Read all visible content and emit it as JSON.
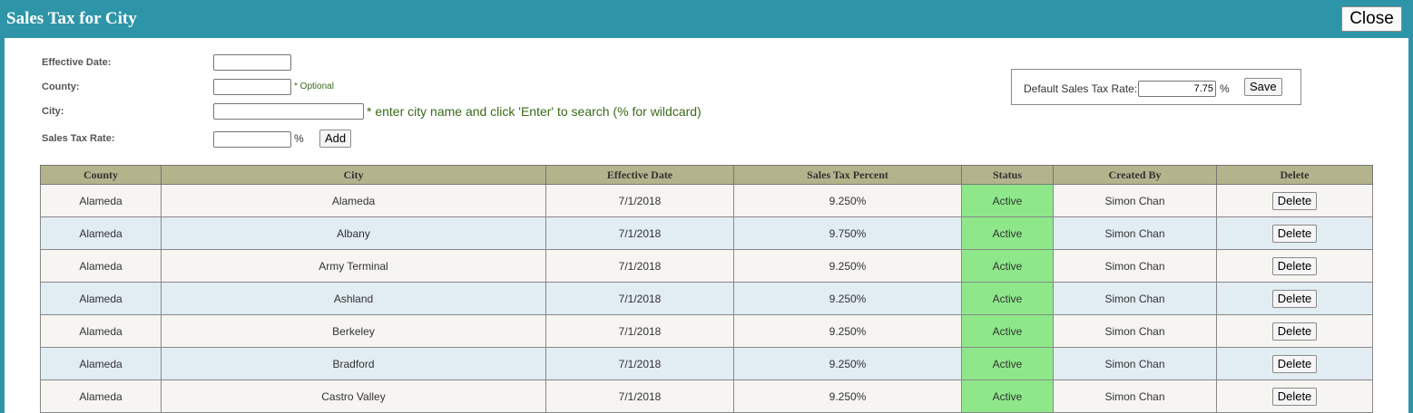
{
  "window": {
    "title": "Sales Tax for City",
    "close_label": "Close"
  },
  "form": {
    "effective_date_label": "Effective Date:",
    "effective_date_value": "",
    "county_label": "County:",
    "county_value": "",
    "county_hint": "* Optional",
    "city_label": "City:",
    "city_value": "",
    "city_hint": "* enter city name and click 'Enter' to search (% for wildcard)",
    "rate_label": "Sales Tax Rate:",
    "rate_value": "",
    "percent_symbol": "%",
    "add_label": "Add"
  },
  "default_rate": {
    "label": "Default Sales Tax Rate:",
    "value": "7.75",
    "percent_symbol": "%",
    "save_label": "Save"
  },
  "table": {
    "headers": [
      "County",
      "City",
      "Effective Date",
      "Sales Tax Percent",
      "Status",
      "Created By",
      "Delete"
    ],
    "delete_label": "Delete",
    "rows": [
      {
        "county": "Alameda",
        "city": "Alameda",
        "effective_date": "7/1/2018",
        "percent": "9.250%",
        "status": "Active",
        "created_by": "Simon Chan"
      },
      {
        "county": "Alameda",
        "city": "Albany",
        "effective_date": "7/1/2018",
        "percent": "9.750%",
        "status": "Active",
        "created_by": "Simon Chan"
      },
      {
        "county": "Alameda",
        "city": "Army Terminal",
        "effective_date": "7/1/2018",
        "percent": "9.250%",
        "status": "Active",
        "created_by": "Simon Chan"
      },
      {
        "county": "Alameda",
        "city": "Ashland",
        "effective_date": "7/1/2018",
        "percent": "9.250%",
        "status": "Active",
        "created_by": "Simon Chan"
      },
      {
        "county": "Alameda",
        "city": "Berkeley",
        "effective_date": "7/1/2018",
        "percent": "9.250%",
        "status": "Active",
        "created_by": "Simon Chan"
      },
      {
        "county": "Alameda",
        "city": "Bradford",
        "effective_date": "7/1/2018",
        "percent": "9.250%",
        "status": "Active",
        "created_by": "Simon Chan"
      },
      {
        "county": "Alameda",
        "city": "Castro Valley",
        "effective_date": "7/1/2018",
        "percent": "9.250%",
        "status": "Active",
        "created_by": "Simon Chan"
      }
    ]
  },
  "colors": {
    "titlebar": "#2e95a8",
    "header_bg": "#b3b38c",
    "status_active": "#8ee88a",
    "row_odd": "#f6f5f2",
    "row_even": "#e2ecf3"
  }
}
